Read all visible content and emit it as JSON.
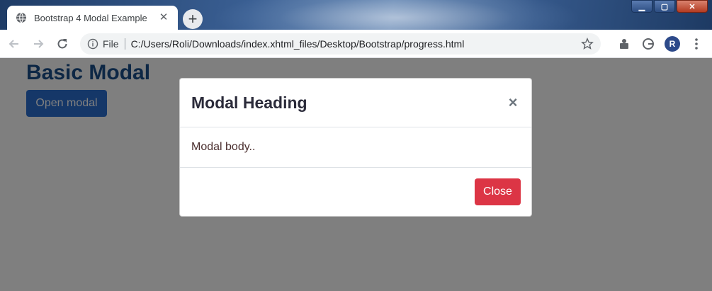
{
  "browser": {
    "tab_title": "Bootstrap 4 Modal Example",
    "address_scheme": "File",
    "address_url": "C:/Users/Roli/Downloads/index.xhtml_files/Desktop/Bootstrap/progress.html",
    "profile_initial": "R"
  },
  "page": {
    "title": "Basic Modal",
    "open_button": "Open modal"
  },
  "modal": {
    "title": "Modal Heading",
    "close_symbol": "×",
    "body": "Modal body..",
    "close_button": "Close"
  },
  "colors": {
    "page_title": "#1a4f8b",
    "primary_button": "#2a6fd1",
    "danger_button": "#dc3545",
    "backdrop": "rgba(0,0,0,0.5)"
  }
}
